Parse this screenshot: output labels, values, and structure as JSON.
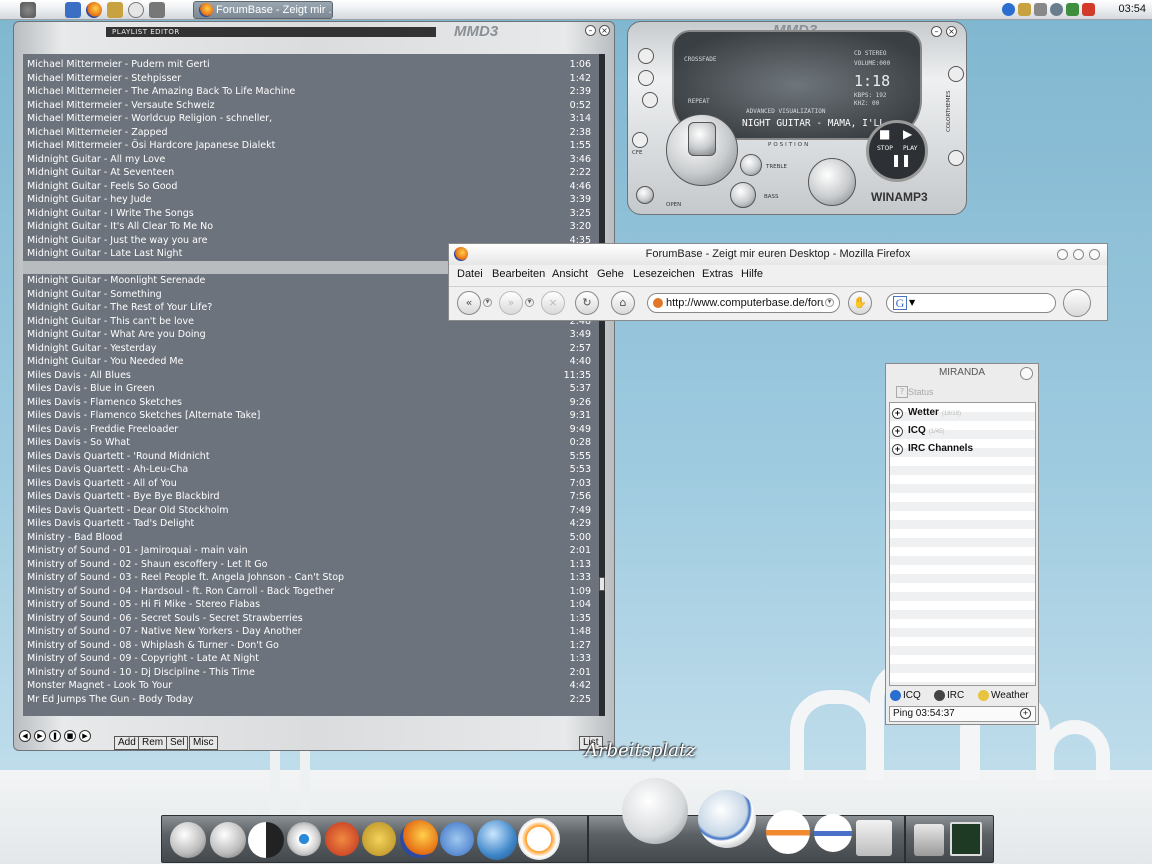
{
  "taskbar": {
    "task_title": "ForumBase - Zeigt mir ...",
    "clock": "03:54"
  },
  "playlist": {
    "title": "PLAYLIST EDITOR",
    "logo": "MMD3",
    "items": [
      {
        "title": "Michael Mittermeier - Pudern mit Gerti",
        "duration": "1:06"
      },
      {
        "title": "Michael Mittermeier - Stehpisser",
        "duration": "1:42"
      },
      {
        "title": "Michael Mittermeier - The Amazing Back To Life Machine",
        "duration": "2:39"
      },
      {
        "title": "Michael Mittermeier - Versaute Schweiz",
        "duration": "0:52"
      },
      {
        "title": "Michael Mittermeier - Worldcup Religion - schneller,",
        "duration": "3:14"
      },
      {
        "title": "Michael Mittermeier - Zapped",
        "duration": "2:38"
      },
      {
        "title": "Michael Mittermeier - Ösi Hardcore Japanese Dialekt",
        "duration": "1:55"
      },
      {
        "title": "Midnight Guitar - All my Love",
        "duration": "3:46"
      },
      {
        "title": "Midnight Guitar - At Seventeen",
        "duration": "2:22"
      },
      {
        "title": "Midnight Guitar - Feels So Good",
        "duration": "4:46"
      },
      {
        "title": "Midnight Guitar - hey Jude",
        "duration": "3:39"
      },
      {
        "title": "Midnight Guitar - I Write The Songs",
        "duration": "3:25"
      },
      {
        "title": "Midnight Guitar - It's All Clear To Me No",
        "duration": "3:20"
      },
      {
        "title": "Midnight Guitar - Just the way you are",
        "duration": "4:35"
      },
      {
        "title": "Midnight Guitar - Late Last Night",
        "duration": ""
      },
      {
        "title": "",
        "duration": ""
      },
      {
        "title": "Midnight Guitar - Moonlight Serenade",
        "duration": ""
      },
      {
        "title": "Midnight Guitar - Something",
        "duration": ""
      },
      {
        "title": "Midnight Guitar - The Rest of Your Life?",
        "duration": ""
      },
      {
        "title": "Midnight Guitar - This can't be love",
        "duration": "2:48"
      },
      {
        "title": "Midnight Guitar - What Are you Doing",
        "duration": "3:49"
      },
      {
        "title": "Midnight Guitar - Yesterday",
        "duration": "2:57"
      },
      {
        "title": "Midnight Guitar - You Needed Me",
        "duration": "4:40"
      },
      {
        "title": "Miles Davis - All Blues",
        "duration": "11:35"
      },
      {
        "title": "Miles Davis - Blue in Green",
        "duration": "5:37"
      },
      {
        "title": "Miles Davis - Flamenco Sketches",
        "duration": "9:26"
      },
      {
        "title": "Miles Davis - Flamenco Sketches [Alternate Take]",
        "duration": "9:31"
      },
      {
        "title": "Miles Davis - Freddie Freeloader",
        "duration": "9:49"
      },
      {
        "title": "Miles Davis - So What",
        "duration": "0:28"
      },
      {
        "title": "Miles Davis Quartett - 'Round Midnicht",
        "duration": "5:55"
      },
      {
        "title": "Miles Davis Quartett - Ah-Leu-Cha",
        "duration": "5:53"
      },
      {
        "title": "Miles Davis Quartett - All of You",
        "duration": "7:03"
      },
      {
        "title": "Miles Davis Quartett - Bye Bye Blackbird",
        "duration": "7:56"
      },
      {
        "title": "Miles Davis Quartett - Dear Old Stockholm",
        "duration": "7:49"
      },
      {
        "title": "Miles Davis Quartett - Tad's Delight",
        "duration": "4:29"
      },
      {
        "title": "Ministry - Bad Blood",
        "duration": "5:00"
      },
      {
        "title": "Ministry of Sound - 01 - Jamiroquai - main vain",
        "duration": "2:01"
      },
      {
        "title": "Ministry of Sound - 02 - Shaun escoffery - Let It Go",
        "duration": "1:13"
      },
      {
        "title": "Ministry of Sound - 03 - Reel People ft. Angela Johnson - Can't Stop",
        "duration": "1:33"
      },
      {
        "title": "Ministry of Sound - 04 - Hardsoul - ft. Ron Carroll - Back Together",
        "duration": "1:09"
      },
      {
        "title": "Ministry of Sound - 05 - Hi Fi Mike - Stereo Flabas",
        "duration": "1:04"
      },
      {
        "title": "Ministry of Sound - 06 - Secret Souls - Secret Strawberries",
        "duration": "1:35"
      },
      {
        "title": "Ministry of Sound - 07 - Native New Yorkers - Day Another",
        "duration": "1:48"
      },
      {
        "title": "Ministry of Sound - 08 - Whiplash & Turner - Don't Go",
        "duration": "1:27"
      },
      {
        "title": "Ministry of Sound - 09 - Copyright - Late At Night",
        "duration": "1:33"
      },
      {
        "title": "Ministry of Sound - 10 - Dj Discipline - This Time",
        "duration": "2:01"
      },
      {
        "title": "Monster Magnet - Look To Your",
        "duration": "4:42"
      },
      {
        "title": "Mr Ed Jumps The Gun - Body Today",
        "duration": "2:25"
      }
    ],
    "buttons": {
      "add": "Add",
      "rem": "Rem",
      "sel": "Sel",
      "misc": "Misc",
      "list": "List"
    }
  },
  "player": {
    "logo": "MMD3",
    "time": "1:18",
    "crossfade": "CROSSFADE",
    "repeat": "REPEAT",
    "cd_stereo": "CD STEREO",
    "volume": "VOLUME:000",
    "kbps": "KBPS: 192",
    "khz": "KHZ: 00",
    "adv_vis": "ADVANCED VISUALIZATION",
    "scroll_text": "NIGHT GUITAR - MAMA, I'LL",
    "position": "POSITION",
    "treble": "TREBLE",
    "bass": "BASS",
    "open": "OPEN",
    "stop": "STOP",
    "play": "PLAY",
    "colorthemes": "COLORTHEMES",
    "winamp": "WINAMP3"
  },
  "firefox": {
    "title": "ForumBase - Zeigt mir euren Desktop - Mozilla Firefox",
    "menu": [
      "Datei",
      "Bearbeiten",
      "Ansicht",
      "Gehe",
      "Lesezeichen",
      "Extras",
      "Hilfe"
    ],
    "url": "http://www.computerbase.de/forum",
    "search_engine": "G"
  },
  "miranda": {
    "title": "MIRANDA",
    "status": "Status",
    "groups": [
      {
        "label": "Wetter",
        "count": "(18/18)"
      },
      {
        "label": "ICQ",
        "count": "(1/45)"
      },
      {
        "label": "IRC Channels",
        "count": ""
      }
    ],
    "tabs": [
      {
        "label": "ICQ",
        "color": "#2a6fd0"
      },
      {
        "label": "IRC",
        "color": "#444444"
      },
      {
        "label": "Weather",
        "color": "#e8c340"
      }
    ],
    "ping": "Ping 03:54:37"
  },
  "desktop": {
    "icon_label": "Arbeitsplatz"
  }
}
